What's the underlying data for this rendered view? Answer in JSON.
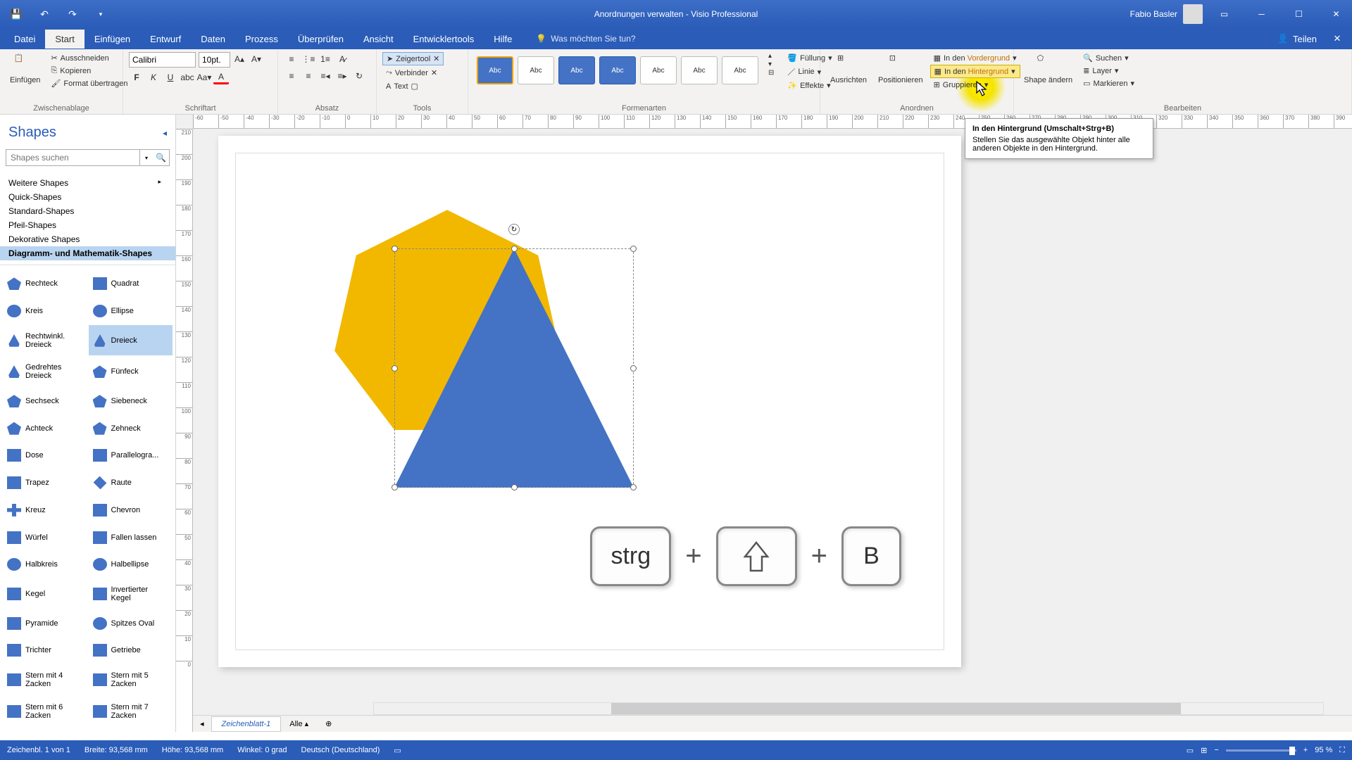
{
  "app": {
    "title": "Anordnungen verwalten  -  Visio Professional",
    "user": "Fabio Basler"
  },
  "menu": {
    "tabs": [
      "Datei",
      "Start",
      "Einfügen",
      "Entwurf",
      "Daten",
      "Prozess",
      "Überprüfen",
      "Ansicht",
      "Entwicklertools",
      "Hilfe"
    ],
    "active": 1,
    "tellme": "Was möchten Sie tun?",
    "share": "Teilen"
  },
  "ribbon": {
    "clipboard": {
      "label": "Zwischenablage",
      "paste": "Einfügen",
      "cut": "Ausschneiden",
      "copy": "Kopieren",
      "format": "Format übertragen"
    },
    "font": {
      "label": "Schriftart",
      "name": "Calibri",
      "size": "10pt."
    },
    "paragraph": {
      "label": "Absatz"
    },
    "tools": {
      "label": "Tools",
      "pointer": "Zeigertool",
      "connector": "Verbinder",
      "text": "Text"
    },
    "styles": {
      "label": "Formenarten",
      "fill": "Füllung",
      "line": "Linie",
      "effects": "Effekte"
    },
    "arrange": {
      "label": "Anordnen",
      "align": "Ausrichten",
      "position": "Positionieren",
      "front": "In den Vordergrund",
      "back": "In den Hintergrund",
      "group": "Gruppieren"
    },
    "edit": {
      "label": "Bearbeiten",
      "shape": "Shape ändern",
      "find": "Suchen",
      "layer": "Layer",
      "select": "Markieren"
    }
  },
  "tooltip": {
    "title": "In den Hintergrund (Umschalt+Strg+B)",
    "body": "Stellen Sie das ausgewählte Objekt hinter alle anderen Objekte in den Hintergrund."
  },
  "shapes": {
    "title": "Shapes",
    "search_ph": "Shapes suchen",
    "cats": [
      "Weitere Shapes",
      "Quick-Shapes",
      "Standard-Shapes",
      "Pfeil-Shapes",
      "Dekorative Shapes",
      "Diagramm- und Mathematik-Shapes"
    ],
    "active_cat": 5,
    "list": [
      "Rechteck",
      "Quadrat",
      "Kreis",
      "Ellipse",
      "Rechtwinkl. Dreieck",
      "Dreieck",
      "Gedrehtes Dreieck",
      "Fünfeck",
      "Sechseck",
      "Siebeneck",
      "Achteck",
      "Zehneck",
      "Dose",
      "Parallelogra...",
      "Trapez",
      "Raute",
      "Kreuz",
      "Chevron",
      "Würfel",
      "Fallen lassen",
      "Halbkreis",
      "Halbellipse",
      "Kegel",
      "Invertierter Kegel",
      "Pyramide",
      "Spitzes Oval",
      "Trichter",
      "Getriebe",
      "Stern mit 4 Zacken",
      "Stern mit 5 Zacken",
      "Stern mit 6 Zacken",
      "Stern mit 7 Zacken"
    ],
    "selected_shape": 5
  },
  "keys": {
    "k1": "strg",
    "k2": "⇧",
    "k3": "B"
  },
  "sheet": {
    "name": "Zeichenblatt-1",
    "all": "Alle"
  },
  "status": {
    "page": "Zeichenbl. 1 von 1",
    "width": "Breite: 93,568 mm",
    "height": "Höhe: 93,568 mm",
    "angle": "Winkel: 0 grad",
    "lang": "Deutsch (Deutschland)",
    "zoom": "95 %"
  }
}
